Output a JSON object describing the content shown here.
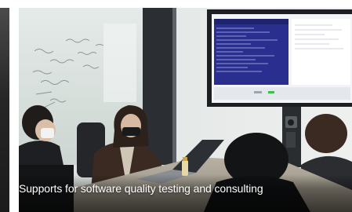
{
  "slide": {
    "caption": "Supports for software quality testing and consulting"
  }
}
